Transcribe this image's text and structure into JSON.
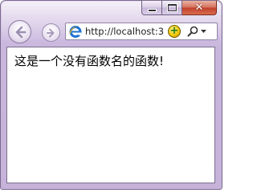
{
  "browser": {
    "address": {
      "url": "http://localhost:3"
    },
    "icons": {
      "back": "back-arrow-icon",
      "forward": "forward-arrow-icon",
      "site": "ie-logo-icon",
      "compat": "add-icon",
      "search": "search-icon"
    }
  },
  "page": {
    "text": "这是一个没有函数名的函数!"
  }
}
